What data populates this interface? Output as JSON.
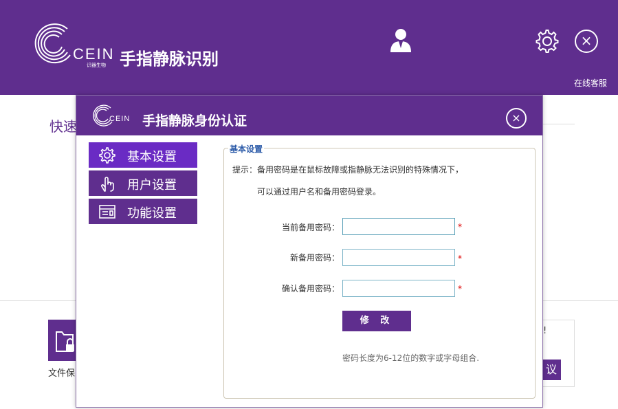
{
  "app": {
    "brand": "CEIN",
    "brand_sub": "识器生物",
    "title": "手指静脉识别",
    "online_service": "在线客服",
    "close_label": "×"
  },
  "background": {
    "quick_label": "快速",
    "file_label": "文件保",
    "excl": "!",
    "btn_fragment": "议"
  },
  "dialog": {
    "brand": "CEIN",
    "title": "手指静脉身份认证",
    "close_label": "×",
    "menu": [
      {
        "label": "基本设置",
        "icon": "gear-icon",
        "active": true
      },
      {
        "label": "用户设置",
        "icon": "finger-icon",
        "active": false
      },
      {
        "label": "功能设置",
        "icon": "window-icon",
        "active": false
      }
    ],
    "panel": {
      "legend": "基本设置",
      "hint_line1": "提示：备用密码是在鼠标故障或指静脉无法识别的特殊情况下，",
      "hint_line2": "可以通过用户名和备用密码登录。",
      "fields": [
        {
          "label": "当前备用密码：",
          "value": "",
          "required": "*"
        },
        {
          "label": "新备用密码：",
          "value": "",
          "required": "*"
        },
        {
          "label": "确认备用密码：",
          "value": "",
          "required": "*"
        }
      ],
      "submit_label": "修 改",
      "note": "密码长度为6-12位的数字或字母组合."
    }
  },
  "colors": {
    "brand_purple": "#5f2e8e",
    "active_menu": "#6a2bc4",
    "legend_blue": "#2b5aa8",
    "required_red": "#dd0000"
  }
}
